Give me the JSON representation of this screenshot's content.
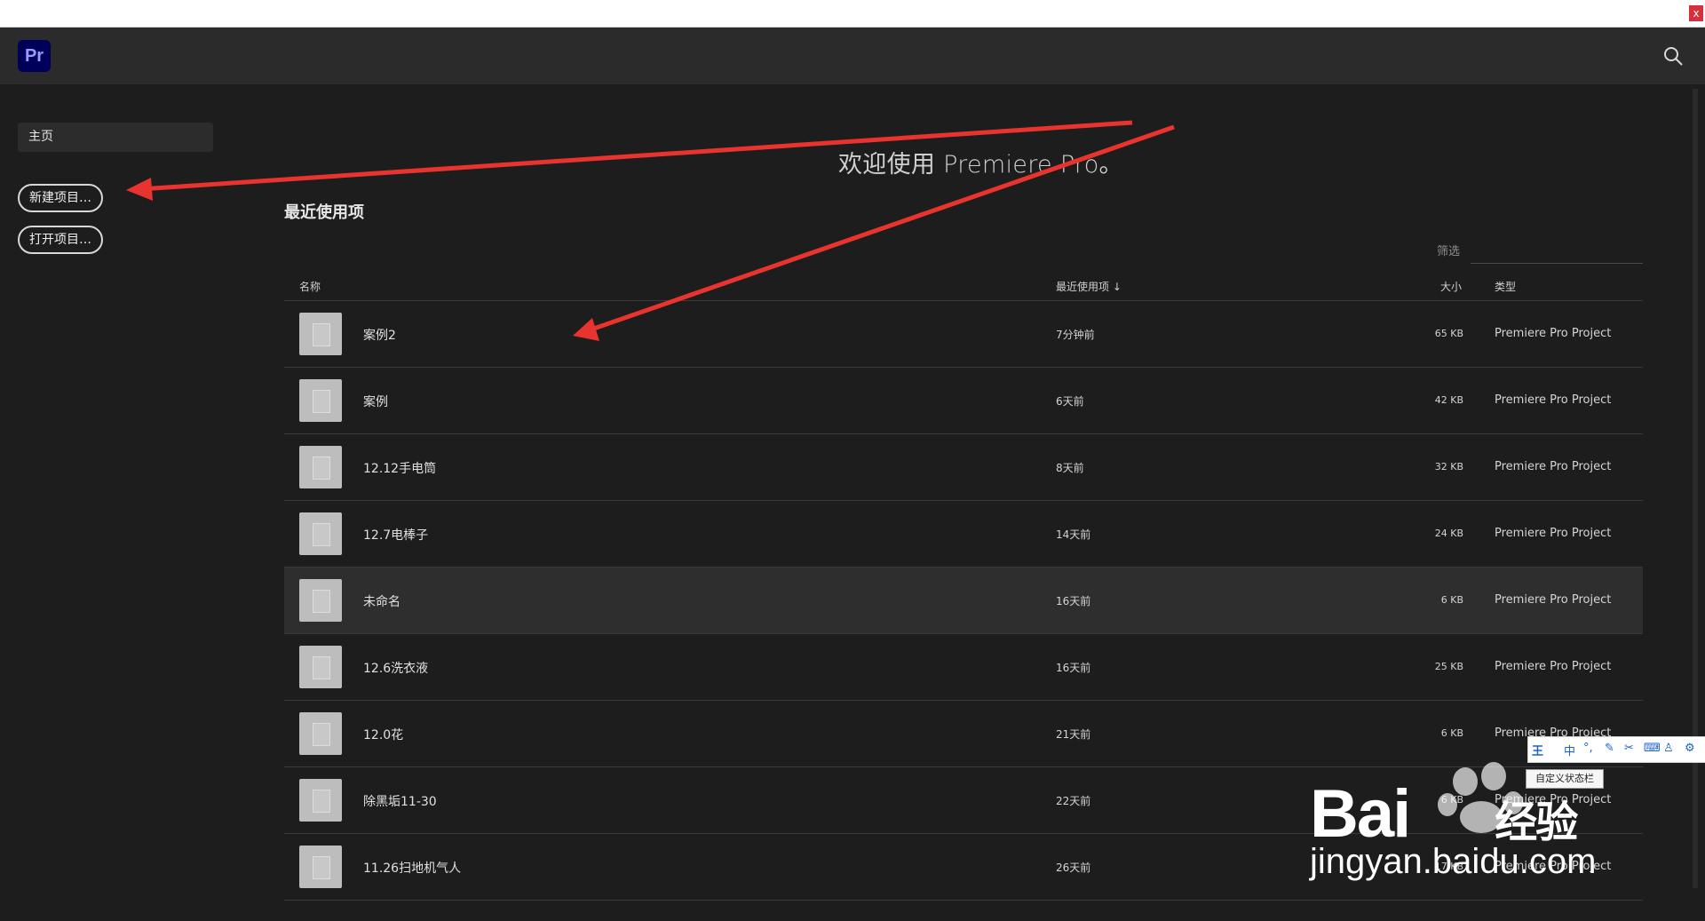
{
  "window": {
    "close_label": "x"
  },
  "app": {
    "logo_text": "Pr"
  },
  "sidebar": {
    "home_label": "主页",
    "new_project_label": "新建项目…",
    "open_project_label": "打开项目…"
  },
  "main": {
    "welcome": "欢迎使用 Premiere Pro。",
    "recent_title": "最近使用项",
    "filter_label": "筛选",
    "columns": {
      "name": "名称",
      "recent": "最近使用项 ↓",
      "size": "大小",
      "type": "类型"
    },
    "rows": [
      {
        "name": "案例2",
        "time": "7分钟前",
        "size": "65 KB",
        "type": "Premiere Pro Project"
      },
      {
        "name": "案例",
        "time": "6天前",
        "size": "42 KB",
        "type": "Premiere Pro Project"
      },
      {
        "name": "12.12手电筒",
        "time": "8天前",
        "size": "32 KB",
        "type": "Premiere Pro Project"
      },
      {
        "name": "12.7电棒子",
        "time": "14天前",
        "size": "24 KB",
        "type": "Premiere Pro Project"
      },
      {
        "name": "未命名",
        "time": "16天前",
        "size": "6 KB",
        "type": "Premiere Pro Project"
      },
      {
        "name": "12.6洗衣液",
        "time": "16天前",
        "size": "25 KB",
        "type": "Premiere Pro Project"
      },
      {
        "name": "12.0花",
        "time": "21天前",
        "size": "6 KB",
        "type": "Premiere Pro Project"
      },
      {
        "name": "除黑垢11-30",
        "time": "22天前",
        "size": "6 KB",
        "type": "Premiere Pro Project"
      },
      {
        "name": "11.26扫地机气人",
        "time": "26天前",
        "size": "17 KB",
        "type": "Premiere Pro Project"
      }
    ]
  },
  "ime": {
    "chars": [
      "王",
      "中"
    ],
    "tooltip": "自定义状态栏"
  },
  "watermark": {
    "line1": "Bai",
    "line1b": "经验",
    "line2": "jingyan.baidu.com"
  },
  "colors": {
    "accent_arrow": "#e8332f",
    "pr_brand": "#00005b"
  }
}
